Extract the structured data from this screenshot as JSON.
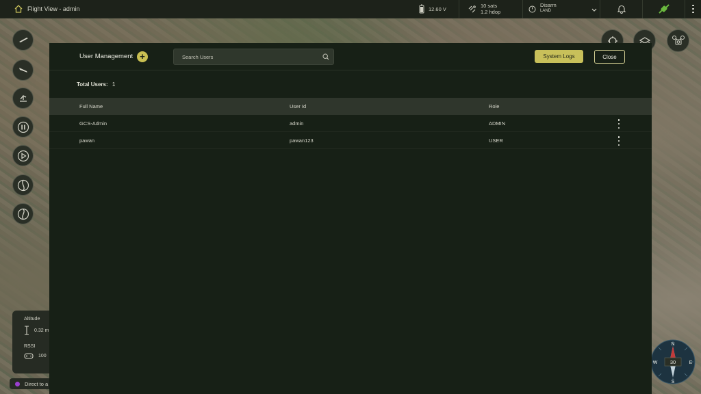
{
  "topbar": {
    "title": "Flight View - admin",
    "battery": "12.60 V",
    "gps": {
      "sats": "10 sats",
      "hdop": "1.2 hdop"
    },
    "arm": {
      "state": "Disarm",
      "mode": "LAND"
    }
  },
  "left_tools": [
    "takeoff-icon",
    "land-icon",
    "return-home-icon",
    "pause-icon",
    "play-icon",
    "orbit-icon",
    "orbit-alt-icon"
  ],
  "telemetry": {
    "altitude_label": "Altitude",
    "altitude_value": "0.32 m",
    "rssi_label": "RSSI",
    "rssi_value": "100"
  },
  "status": {
    "text": "Direct to a",
    "color": "#9a3fd0"
  },
  "compass": {
    "heading": "30",
    "n": "N",
    "e": "E",
    "s": "S",
    "w": "W"
  },
  "modal": {
    "title": "User Management",
    "add_label": "+",
    "search_placeholder": "Search Users",
    "system_logs_label": "System Logs",
    "close_label": "Close",
    "total_label": "Total Users:",
    "total_value": "1",
    "columns": [
      "Full Name",
      "User Id",
      "Role"
    ],
    "rows": [
      {
        "full_name": "GCS-Admin",
        "user_id": "admin",
        "role": "ADMIN"
      },
      {
        "full_name": "pawan",
        "user_id": "pawan123",
        "role": "USER"
      }
    ]
  },
  "colors": {
    "accent": "#c8c05a",
    "modal_bg": "#172016",
    "link_icon": "#6ab83e"
  }
}
